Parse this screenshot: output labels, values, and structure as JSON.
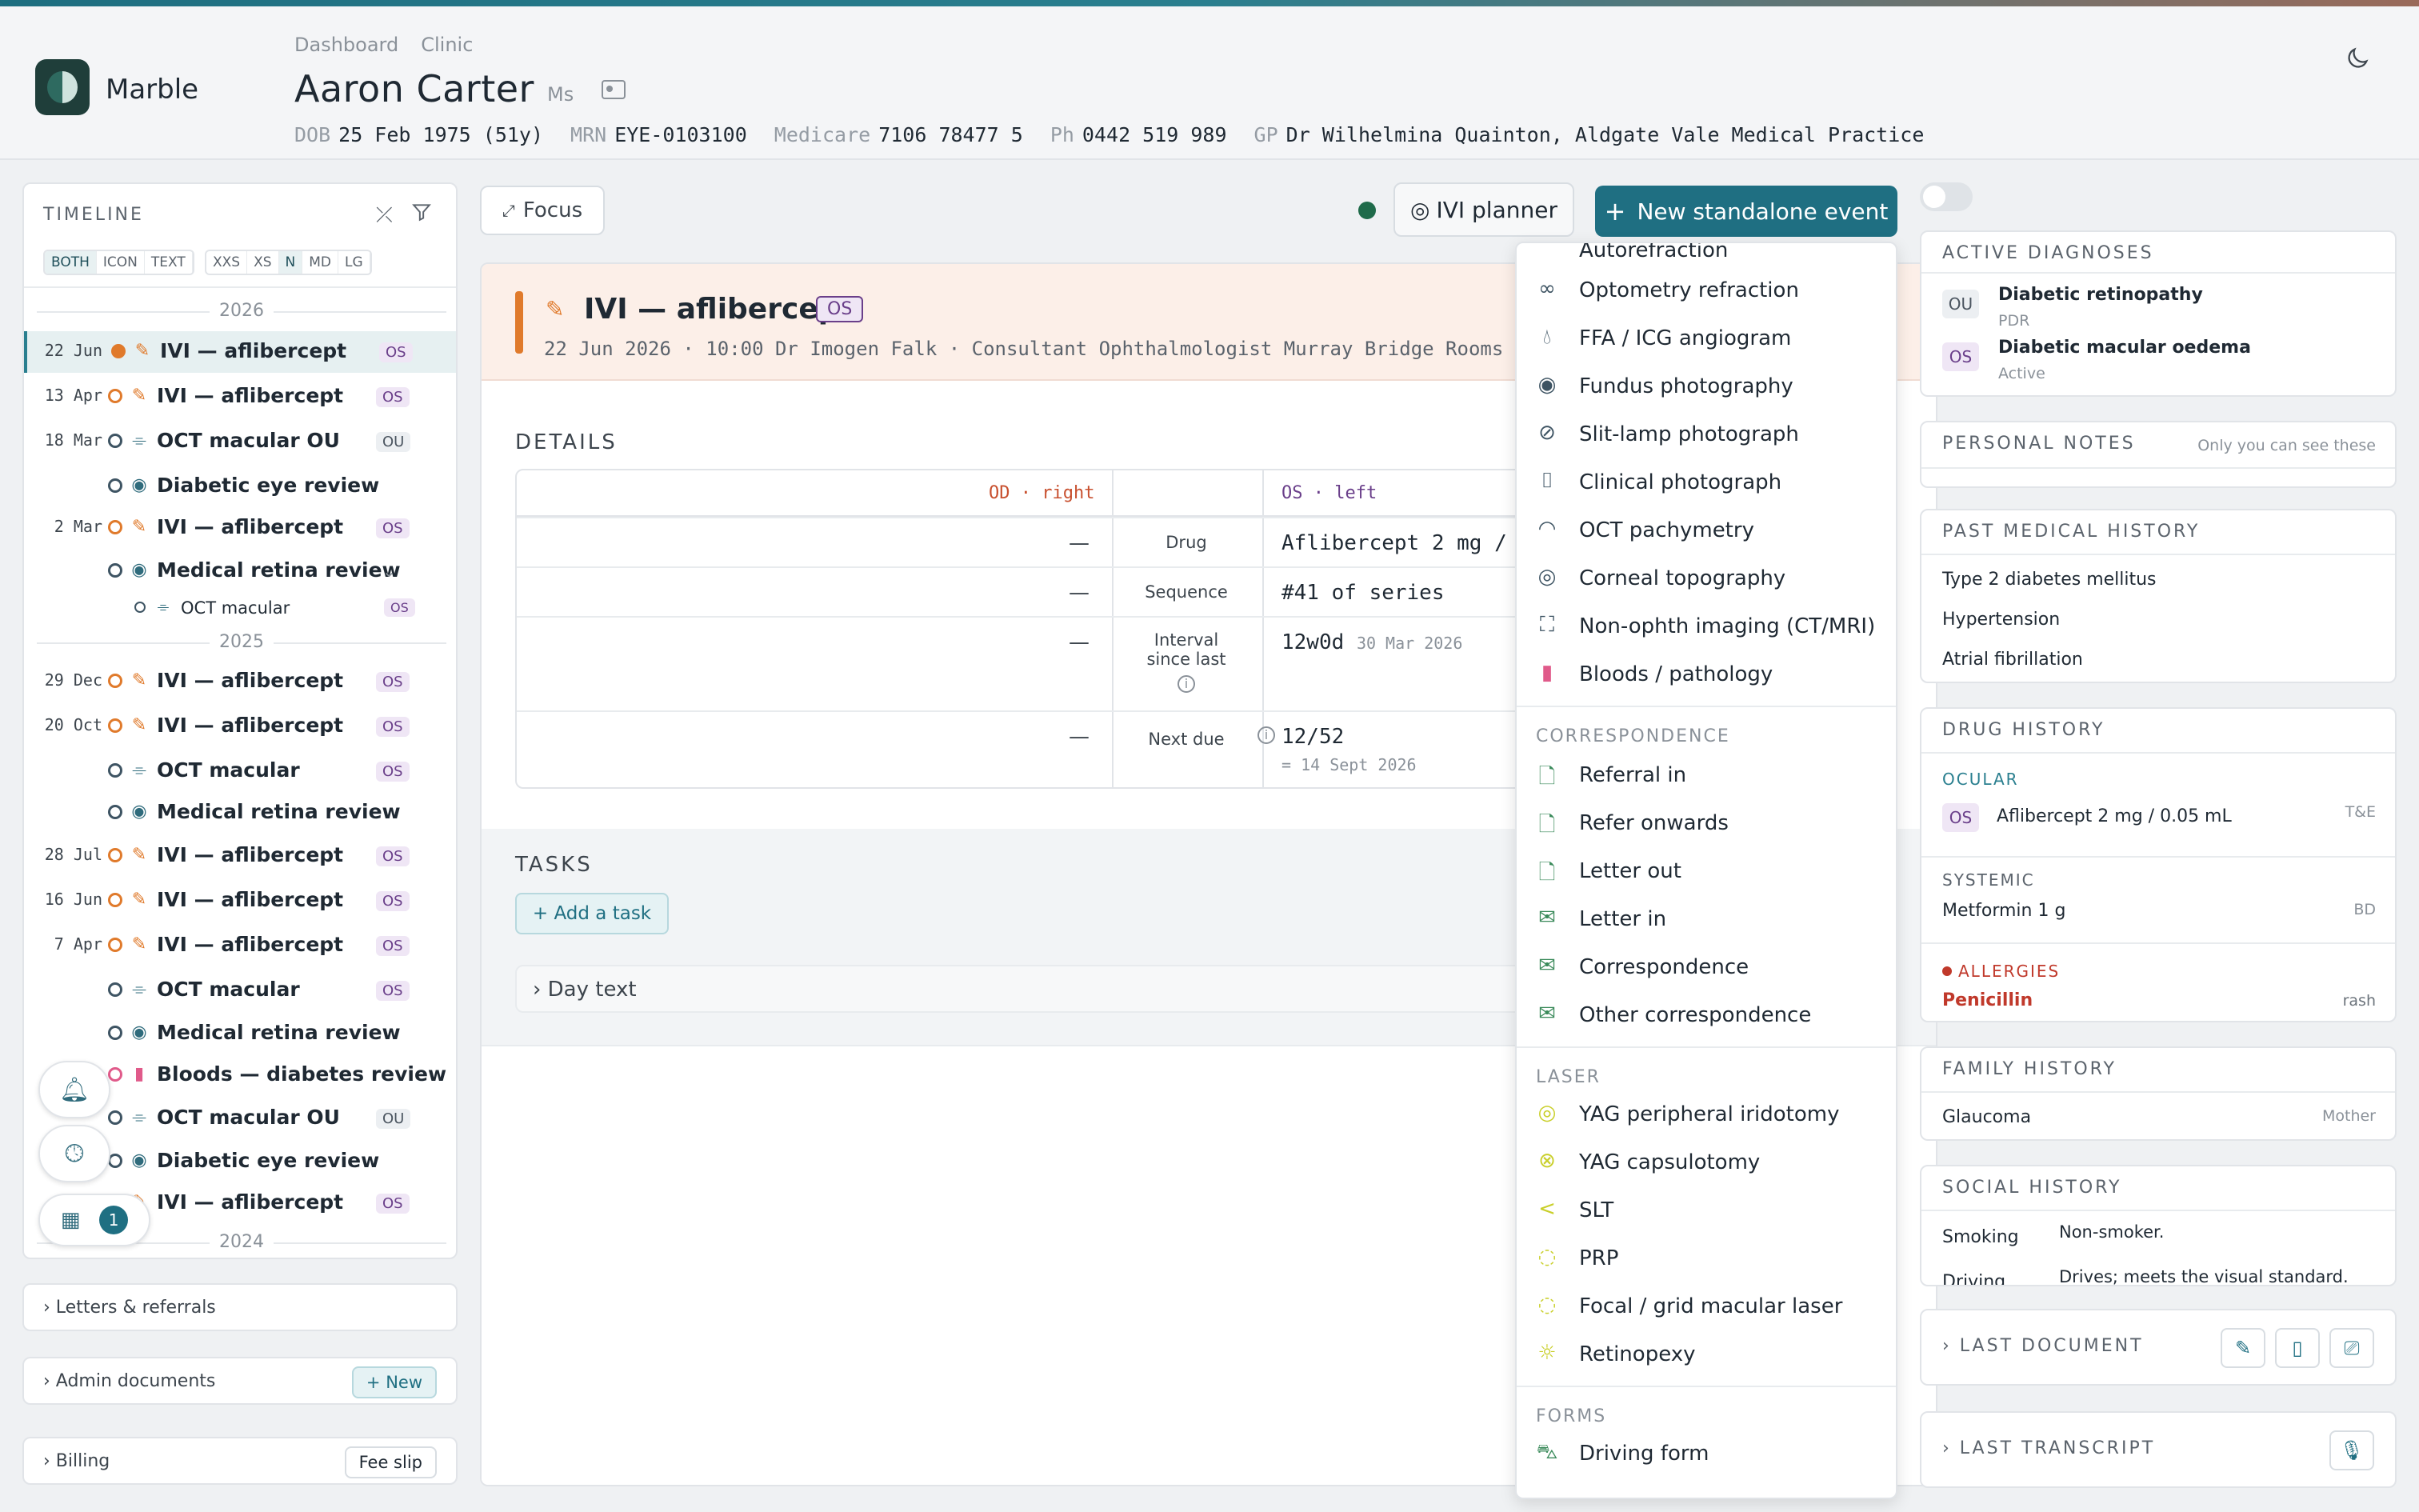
{
  "app": {
    "brand": "Marble"
  },
  "breadcrumbs": [
    "Dashboard",
    "Clinic"
  ],
  "patient": {
    "name": "Aaron Carter",
    "title": "Ms",
    "dob_label": "DOB",
    "dob": "25 Feb 1975 (51y)",
    "mrn_label": "MRN",
    "mrn": "EYE-0103100",
    "medicare_label": "Medicare",
    "medicare": "7106 78477 5",
    "ph_label": "Ph",
    "ph": "0442 519 989",
    "gp_label": "GP",
    "gp": "Dr Wilhelmina Quainton, Aldgate Vale Medical Practice"
  },
  "timeline": {
    "title": "TIMELINE",
    "view_modes": [
      "BOTH",
      "ICON",
      "TEXT"
    ],
    "sizes": [
      "XXS",
      "XS",
      "N",
      "MD",
      "LG"
    ],
    "years": [
      "2026",
      "2025",
      "2024"
    ],
    "rows": [
      {
        "date": "22 Jun",
        "label": "IVI — aflibercept",
        "badge": "OS"
      },
      {
        "date": "13 Apr",
        "label": "IVI — aflibercept",
        "badge": "OS"
      },
      {
        "date": "18 Mar",
        "label": "OCT macular OU",
        "badge": "OU"
      },
      {
        "date": "",
        "label": "Diabetic eye review",
        "badge": ""
      },
      {
        "date": "2 Mar",
        "label": "IVI — aflibercept",
        "badge": "OS"
      },
      {
        "date": "",
        "label": "Medical retina review",
        "badge": ""
      },
      {
        "date": "",
        "label": "OCT macular",
        "badge": "OS"
      },
      {
        "date": "29 Dec",
        "label": "IVI — aflibercept",
        "badge": "OS"
      },
      {
        "date": "20 Oct",
        "label": "IVI — aflibercept",
        "badge": "OS"
      },
      {
        "date": "",
        "label": "OCT macular",
        "badge": "OS"
      },
      {
        "date": "",
        "label": "Medical retina review",
        "badge": ""
      },
      {
        "date": "28 Jul",
        "label": "IVI — aflibercept",
        "badge": "OS"
      },
      {
        "date": "16 Jun",
        "label": "IVI — aflibercept",
        "badge": "OS"
      },
      {
        "date": "7 Apr",
        "label": "IVI — aflibercept",
        "badge": "OS"
      },
      {
        "date": "",
        "label": "OCT macular",
        "badge": "OS"
      },
      {
        "date": "",
        "label": "Medical retina review",
        "badge": ""
      },
      {
        "date": "",
        "label": "Bloods — diabetes review",
        "badge": ""
      },
      {
        "date": "",
        "label": "OCT macular OU",
        "badge": "OU"
      },
      {
        "date": "",
        "label": "Diabetic eye review",
        "badge": ""
      },
      {
        "date": "",
        "label": "IVI — aflibercept",
        "badge": "OS"
      }
    ],
    "calendar_count": "1"
  },
  "left_sections": {
    "letters": "Letters & referrals",
    "admin": "Admin documents",
    "admin_btn": "+ New",
    "billing": "Billing",
    "billing_btn": "Fee slip"
  },
  "toolbar": {
    "focus": "Focus",
    "ivi_planner": "IVI planner",
    "new_event": "New standalone event"
  },
  "event": {
    "title": "IVI — aflibercept",
    "badge": "OS",
    "meta": "22 Jun 2026 · 10:00   Dr Imogen Falk · Consultant Ophthalmologist   Murray Bridge Rooms",
    "details_title": "DETAILS",
    "od_header": "OD · right",
    "os_header": "OS · left",
    "rows": [
      {
        "od": "—",
        "label": "Drug",
        "os": "Aflibercept 2 mg /",
        "sub": ""
      },
      {
        "od": "—",
        "label": "Sequence",
        "os": "#41 of series",
        "sub": ""
      },
      {
        "od": "—",
        "label": "Interval since last",
        "os": "12w0d",
        "sub": "30 Mar 2026"
      },
      {
        "od": "—",
        "label": "Next due",
        "os": "12/52",
        "sub": "= 14 Sept 2026"
      }
    ],
    "tasks_title": "TASKS",
    "add_task": "+ Add a task",
    "day_text": "› Day text"
  },
  "menu": {
    "partial_top": "Autorefraction",
    "imaging": [
      {
        "icon": "glasses-icon",
        "label": "Optometry refraction"
      },
      {
        "icon": "drop-icon",
        "label": "FFA / ICG angiogram"
      },
      {
        "icon": "eye-icon",
        "label": "Fundus photography"
      },
      {
        "icon": "eye-slash-icon",
        "label": "Slit-lamp photograph"
      },
      {
        "icon": "camera-icon",
        "label": "Clinical photograph"
      },
      {
        "icon": "gauge-icon",
        "label": "OCT pachymetry"
      },
      {
        "icon": "target-icon",
        "label": "Corneal topography"
      },
      {
        "icon": "scan-icon",
        "label": "Non-ophth imaging (CT/MRI)"
      },
      {
        "icon": "test-tube-icon",
        "label": "Bloods / pathology"
      }
    ],
    "correspondence_title": "CORRESPONDENCE",
    "correspondence": [
      {
        "icon": "file-in-icon",
        "label": "Referral in"
      },
      {
        "icon": "file-out-icon",
        "label": "Refer onwards"
      },
      {
        "icon": "file-out-icon",
        "label": "Letter out"
      },
      {
        "icon": "mail-icon",
        "label": "Letter in"
      },
      {
        "icon": "mail-icon",
        "label": "Correspondence"
      },
      {
        "icon": "mail-icon",
        "label": "Other correspondence"
      }
    ],
    "laser_title": "LASER",
    "laser": [
      {
        "icon": "circle-dot-icon",
        "label": "YAG peripheral iridotomy"
      },
      {
        "icon": "circle-x-icon",
        "label": "YAG capsulotomy"
      },
      {
        "icon": "chevron-left-icon",
        "label": "SLT"
      },
      {
        "icon": "circle-dashed-icon",
        "label": "PRP"
      },
      {
        "icon": "circle-dashed-icon",
        "label": "Focal / grid macular laser"
      },
      {
        "icon": "sun-icon",
        "label": "Retinopexy"
      }
    ],
    "forms_title": "FORMS",
    "forms": [
      {
        "icon": "car-icon",
        "label": "Driving form"
      }
    ]
  },
  "right": {
    "diagnoses_title": "ACTIVE DIAGNOSES",
    "diagnoses": [
      {
        "badge": "OU",
        "name": "Diabetic retinopathy",
        "sub": "PDR"
      },
      {
        "badge": "OS",
        "name": "Diabetic macular oedema",
        "sub": "Active"
      }
    ],
    "notes_title": "PERSONAL NOTES",
    "notes_hint": "Only you can see these",
    "pmh_title": "PAST MEDICAL HISTORY",
    "pmh": [
      "Type 2 diabetes mellitus",
      "Hypertension",
      "Atrial fibrillation"
    ],
    "drug_title": "DRUG HISTORY",
    "ocular_title": "OCULAR",
    "ocular_badge": "OS",
    "ocular_drug": "Aflibercept 2 mg / 0.05 mL",
    "ocular_freq": "T&E",
    "systemic_title": "SYSTEMIC",
    "systemic_drug": "Metformin 1 g",
    "systemic_freq": "BD",
    "allergies_title": "ALLERGIES",
    "allergy": "Penicillin",
    "allergy_reaction": "rash",
    "family_title": "FAMILY HISTORY",
    "family_item": "Glaucoma",
    "family_rel": "Mother",
    "social_title": "SOCIAL HISTORY",
    "social": [
      {
        "k": "Smoking",
        "v": "Non-smoker."
      },
      {
        "k": "Driving",
        "v": "Drives; meets the visual standard."
      }
    ],
    "last_doc": "LAST DOCUMENT",
    "last_transcript": "LAST TRANSCRIPT"
  }
}
